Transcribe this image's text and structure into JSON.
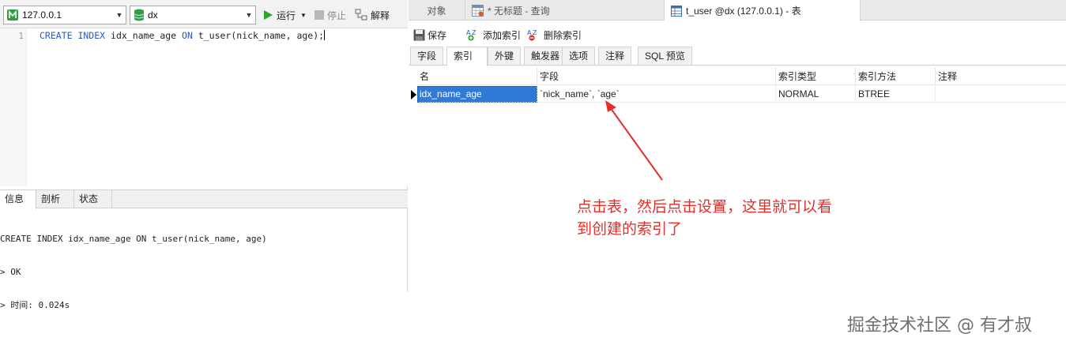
{
  "left": {
    "connection": "127.0.0.1",
    "database": "dx",
    "run_label": "运行",
    "stop_label": "停止",
    "explain_label": "解释",
    "editor": {
      "line_number": "1",
      "code_keyword_1": "CREATE INDEX",
      "code_part_1": " idx_name_age ",
      "code_keyword_2": "ON",
      "code_part_2": " t_user(nick_name, age);"
    },
    "bottom_tabs": [
      "信息",
      "剖析",
      "状态"
    ],
    "log_lines": [
      "CREATE INDEX idx_name_age ON t_user(nick_name, age)",
      "> OK",
      "> 时间: 0.024s"
    ]
  },
  "right": {
    "window_tabs": [
      {
        "label": "对象",
        "active": false
      },
      {
        "label": "* 无标题 - 查询",
        "active": false
      },
      {
        "label": "t_user @dx (127.0.0.1) - 表",
        "active": true
      }
    ],
    "actions": {
      "save": "保存",
      "add_index": "添加索引",
      "delete_index": "删除索引"
    },
    "sub_tabs": [
      "字段",
      "索引",
      "外键",
      "触发器",
      "选项",
      "注释",
      "SQL 预览"
    ],
    "active_sub_tab": "索引",
    "grid": {
      "columns": [
        "名",
        "字段",
        "索引类型",
        "索引方法",
        "注释"
      ],
      "rows": [
        [
          "idx_name_age",
          "`nick_name`, `age`",
          "NORMAL",
          "BTREE",
          ""
        ]
      ]
    }
  },
  "annotation": {
    "line1": "点击表，然后点击设置，这里就可以看",
    "line2": "到创建的索引了",
    "color": "#e0312b"
  },
  "watermark": "掘金技术社区 @ 有才叔",
  "colors": {
    "selection": "#2f7ad6",
    "keyword": "#2b56c8",
    "run_icon": "#2aa52a"
  }
}
